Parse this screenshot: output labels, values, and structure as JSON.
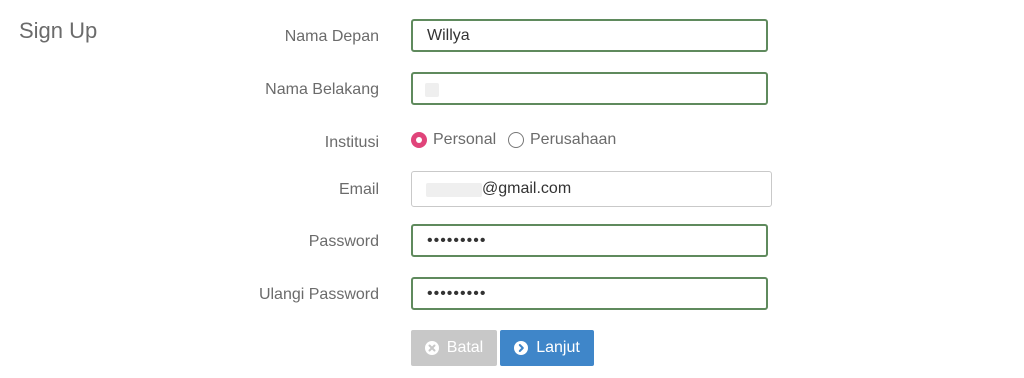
{
  "page": {
    "title": "Sign Up"
  },
  "form": {
    "first_name": {
      "label": "Nama Depan",
      "value": "Willya"
    },
    "last_name": {
      "label": "Nama Belakang",
      "value": ""
    },
    "institution": {
      "label": "Institusi",
      "options": [
        {
          "label": "Personal",
          "selected": true
        },
        {
          "label": "Perusahaan",
          "selected": false
        }
      ]
    },
    "email": {
      "label": "Email",
      "value_visible": "@gmail.com"
    },
    "password": {
      "label": "Password",
      "value": "•••••••••"
    },
    "confirm_password": {
      "label": "Ulangi Password",
      "value": "•••••••••"
    }
  },
  "actions": {
    "cancel": {
      "label": "Batal",
      "icon": "close-circle-icon"
    },
    "next": {
      "label": "Lanjut",
      "icon": "chevron-right-circle-icon"
    }
  },
  "colors": {
    "field_border_focus": "#5f8a5d",
    "radio_selected": "#e0447a",
    "primary_button": "#3f86c9",
    "disabled_button": "#c8c8c8",
    "label_text": "#6b6b6b"
  }
}
